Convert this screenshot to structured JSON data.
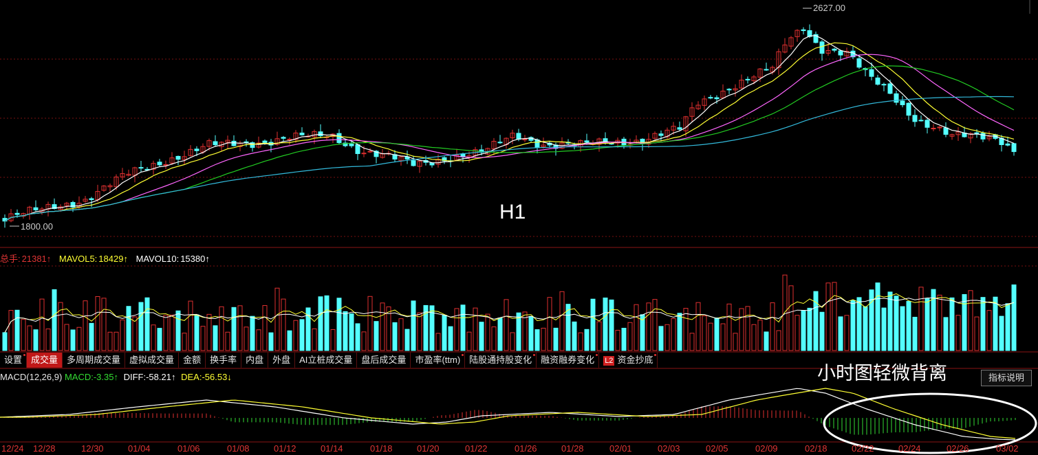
{
  "price_panel": {
    "high_label": "2627.00",
    "low_label": "1800.00",
    "period_label": "H1",
    "colors": {
      "up": "#e03030",
      "down": "#54ffff",
      "ma5": "#ffffff",
      "ma10": "#ffff33",
      "ma20": "#ff66ff",
      "ma30": "#22cc22",
      "ma60": "#33bbdd"
    }
  },
  "volume_panel": {
    "total_label": "总手:",
    "total_value": "21381↑",
    "mavol5_label": "MAVOL5:",
    "mavol5_value": "18429↑",
    "mavol10_label": "MAVOL10:",
    "mavol10_value": "15380↑"
  },
  "tabs": [
    {
      "label": "设置",
      "dot": true,
      "active": false
    },
    {
      "label": "成交量",
      "dot": false,
      "active": true
    },
    {
      "label": "多周期成交量",
      "dot": false,
      "active": false
    },
    {
      "label": "虚拟成交量",
      "dot": false,
      "active": false
    },
    {
      "label": "金额",
      "dot": false,
      "active": false
    },
    {
      "label": "换手率",
      "dot": false,
      "active": false
    },
    {
      "label": "内盘",
      "dot": false,
      "active": false
    },
    {
      "label": "外盘",
      "dot": false,
      "active": false
    },
    {
      "label": "AI立桩成交量",
      "dot": false,
      "active": false
    },
    {
      "label": "盘后成交量",
      "dot": false,
      "active": false
    },
    {
      "label": "市盈率(ttm)",
      "dot": true,
      "active": false
    },
    {
      "label": "陆股通持股变化",
      "dot": true,
      "active": false
    },
    {
      "label": "融资融券变化",
      "dot": true,
      "active": false
    },
    {
      "label": "资金抄底",
      "dot": true,
      "active": false,
      "badge": "L2"
    }
  ],
  "macd_panel": {
    "title": "MACD(12,26,9)",
    "macd_label": "MACD:",
    "macd_value": "-3.35↑",
    "diff_label": "DIFF:",
    "diff_value": "-58.21↑",
    "dea_label": "DEA:",
    "dea_value": "-56.53↓",
    "help_button": "指标说明",
    "annotation": "小时图轻微背离"
  },
  "dates": [
    "12/24",
    "12/28",
    "12/30",
    "01/04",
    "01/06",
    "01/08",
    "01/12",
    "01/14",
    "01/18",
    "01/20",
    "01/22",
    "01/26",
    "01/28",
    "02/01",
    "02/03",
    "02/05",
    "02/09",
    "02/18",
    "02/22",
    "02/24",
    "02/26",
    "03/02"
  ]
}
